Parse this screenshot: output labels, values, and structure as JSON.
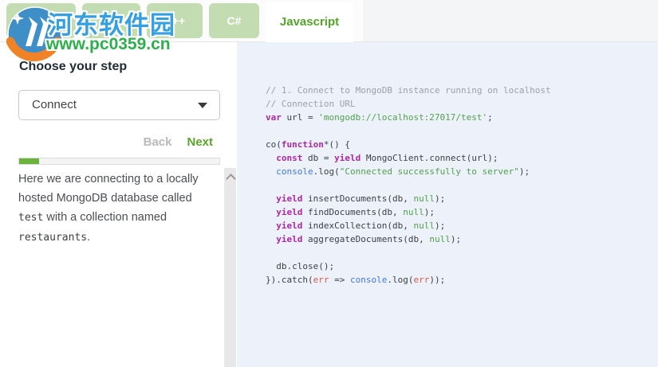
{
  "tabs": [
    {
      "label": "Python",
      "slug": "python",
      "active": false
    },
    {
      "label": "Java",
      "slug": "java",
      "active": false
    },
    {
      "label": "C++",
      "slug": "cpp",
      "active": false
    },
    {
      "label": "C#",
      "slug": "csharp",
      "active": false
    },
    {
      "label": "Javascript",
      "slug": "javascript",
      "active": true
    }
  ],
  "sidebar": {
    "heading": "Choose your step",
    "step_select": {
      "value": "Connect"
    },
    "back_label": "Back",
    "next_label": "Next",
    "progress_percent": 10,
    "description_parts": [
      {
        "t": "text",
        "v": "Here we are connecting to a locally hosted MongoDB database called "
      },
      {
        "t": "code",
        "v": "test"
      },
      {
        "t": "text",
        "v": " with a collection named "
      },
      {
        "t": "code",
        "v": "restaurants"
      },
      {
        "t": "text",
        "v": "."
      }
    ]
  },
  "code": {
    "language": "javascript",
    "lines": [
      [
        [
          "c",
          "// 1. Connect to MongoDB instance running on localhost"
        ]
      ],
      [
        [
          "c",
          "// Connection URL"
        ]
      ],
      [
        [
          "k",
          "var"
        ],
        [
          "p",
          " url = "
        ],
        [
          "s",
          "'mongodb://localhost:27017/test'"
        ],
        [
          "p",
          ";"
        ]
      ],
      [],
      [
        [
          "p",
          "co("
        ],
        [
          "k",
          "function"
        ],
        [
          "p",
          "*() {"
        ]
      ],
      [
        [
          "p",
          "  "
        ],
        [
          "k",
          "const"
        ],
        [
          "p",
          " db = "
        ],
        [
          "k",
          "yield"
        ],
        [
          "p",
          " MongoClient.connect(url);"
        ]
      ],
      [
        [
          "p",
          "  "
        ],
        [
          "b",
          "console"
        ],
        [
          "p",
          ".log("
        ],
        [
          "s",
          "\"Connected successfully to server\""
        ],
        [
          "p",
          ");"
        ]
      ],
      [],
      [
        [
          "p",
          "  "
        ],
        [
          "k",
          "yield"
        ],
        [
          "p",
          " insertDocuments(db, "
        ],
        [
          "s",
          "null"
        ],
        [
          "p",
          ");"
        ]
      ],
      [
        [
          "p",
          "  "
        ],
        [
          "k",
          "yield"
        ],
        [
          "p",
          " findDocuments(db, "
        ],
        [
          "s",
          "null"
        ],
        [
          "p",
          ");"
        ]
      ],
      [
        [
          "p",
          "  "
        ],
        [
          "k",
          "yield"
        ],
        [
          "p",
          " indexCollection(db, "
        ],
        [
          "s",
          "null"
        ],
        [
          "p",
          ");"
        ]
      ],
      [
        [
          "p",
          "  "
        ],
        [
          "k",
          "yield"
        ],
        [
          "p",
          " aggregateDocuments(db, "
        ],
        [
          "s",
          "null"
        ],
        [
          "p",
          ");"
        ]
      ],
      [],
      [
        [
          "p",
          "  db.close();"
        ]
      ],
      [
        [
          "p",
          "}).catch("
        ],
        [
          "v",
          "err"
        ],
        [
          "p",
          " => "
        ],
        [
          "b",
          "console"
        ],
        [
          "p",
          ".log("
        ],
        [
          "v",
          "err"
        ],
        [
          "p",
          "));"
        ]
      ]
    ]
  },
  "watermark": {
    "site_name": "河东软件园",
    "site_url": "www.pc0359.cn"
  },
  "colors": {
    "tab_inactive_bg": "#c4dcb2",
    "tab_active_text": "#55a32a",
    "next_green": "#5ba42f",
    "progress_fill": "#6ab43c",
    "code_panel_bg": "#edf1f9",
    "code_comment": "#9ca1a8",
    "code_keyword": "#ab27a5",
    "code_string": "#50a14f",
    "code_builtin_blue": "#4078f2",
    "code_variable_red": "#e45649",
    "watermark_blue": "#369fe0",
    "watermark_green": "#2fae4d"
  }
}
